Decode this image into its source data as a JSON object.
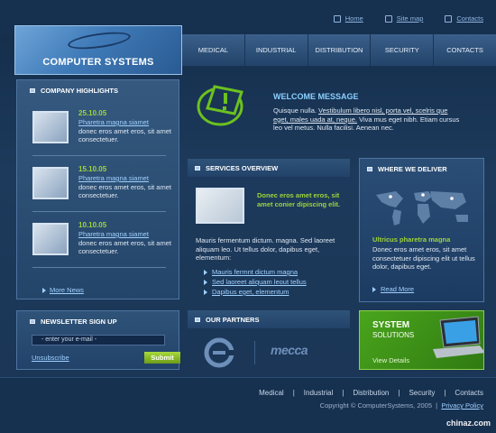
{
  "top_links": [
    {
      "label": "Home",
      "icon": "home-icon"
    },
    {
      "label": "Site map",
      "icon": "sitemap-icon"
    },
    {
      "label": "Contacts",
      "icon": "contacts-icon"
    }
  ],
  "logo": {
    "text": "COMPUTER SYSTEMS"
  },
  "nav": [
    "MEDICAL",
    "INDUSTRIAL",
    "DISTRIBUTION",
    "SECURITY",
    "CONTACTS"
  ],
  "highlights": {
    "title": "COMPANY HIGHLIGHTS",
    "items": [
      {
        "date": "25.10.05",
        "title": "Pharetra magna siamet",
        "desc": "donec eros amet eros, sit amet consectetuer."
      },
      {
        "date": "15.10.05",
        "title": "Pharetra magna siamet",
        "desc": "donec eros amet eros, sit amet consectetuer."
      },
      {
        "date": "10.10.05",
        "title": "Pharetra magna siamet",
        "desc": "donec eros amet eros, sit amet consectetuer."
      }
    ],
    "more": "More News"
  },
  "newsletter": {
    "title": "NEWSLETTER SIGN UP",
    "placeholder": "- enter your e-mail -",
    "unsubscribe": "Unsubscribe",
    "submit": "Submit"
  },
  "welcome": {
    "title": "WELCOME MESSAGE",
    "text_pre": "Quisque nulla. ",
    "link1": "Vestibulum libero nisl, porta vel, scelris que eget, males uada at, neque.",
    "text_post": " Viva mus eget nibh. Etiam cursus leo vel metus. Nulla facilisi. Aenean nec."
  },
  "services": {
    "title": "SERVICES OVERVIEW",
    "lead": "Donec eros amet eros, sit amet conier dipiscing elit.",
    "text": "Mauris fermentum dictum. magna. Sed laoreet aliquam leo. Ut tellus dolor, dapibus eget, elementum:",
    "links": [
      "Mauris fermnt dictum magna",
      "Sed laoreet aliquam leout tellus",
      "Dapibus eget, elementum"
    ]
  },
  "deliver": {
    "title": "WHERE WE DELIVER",
    "subtitle": "Ultricus pharetra magna",
    "text": "Donec eros amet eros, sit amet consectetuer dipiscing elit ut tellus dolor, dapibus eget.",
    "read_more": "Read More"
  },
  "partners": {
    "title": "OUR PARTNERS",
    "partner2": "mecca"
  },
  "promo": {
    "title": "SYSTEM",
    "subtitle": "SOLUTIONS",
    "view": "View Details"
  },
  "footer": {
    "nav": [
      "Medical",
      "Industrial",
      "Distribution",
      "Security",
      "Contacts"
    ],
    "copyright": "Copyright © ComputerSystems, 2005",
    "privacy": "Privacy Policy"
  },
  "watermark": "chinaz.com",
  "colors": {
    "accent_green": "#9ed43a",
    "link_blue": "#9fd0ff",
    "background": "#1a3554"
  }
}
